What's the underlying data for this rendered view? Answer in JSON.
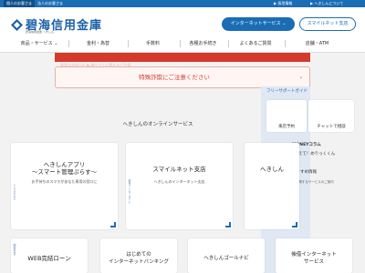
{
  "topbar": {
    "tabs": [
      "個人のお客さま",
      "法人のお客さま"
    ],
    "links": [
      "▶ 採用情報",
      "▶ へきしんについて"
    ]
  },
  "header": {
    "logo_title": "碧海信用金庫",
    "logo_sub": "碧海信用金庫 へきしん",
    "btn_internet": "インターネットサービス  ⌄",
    "btn_smart": "スマイルネット支店"
  },
  "nav": {
    "items": [
      "商品・サービス ⌄",
      "金利・為替",
      "手数料",
      "各種お手続き",
      "よくあるご質問",
      "店舗・ATM"
    ]
  },
  "alerts": {
    "red_text": "重要なお知らせ  ▶  偽サイトに関するご注意",
    "pink_text": "特殊詐欺にご注意ください",
    "pink_arrow": "›"
  },
  "sidebar": {
    "title": "フリーサポートガイド",
    "box1": "来店予約",
    "box2": "チャットで相談",
    "column_title": "MONEYコラム",
    "column_sub": "おしえて！めりっくくん",
    "recommend": "おすすめ情報",
    "recommend_sub": "ご提案に関するサービスのご案内"
  },
  "section": {
    "title": "へきしんのオンラインサービス"
  },
  "cards": [
    {
      "title": "へきしんアプリ\n～スマート管理ぷらす～",
      "desc": "お手持ちのスマホがあなた専用の窓口に",
      "vlabel": "スマホアプリ"
    },
    {
      "title": "スマイルネット支店",
      "desc": "へきしんのインターネット支店",
      "vlabel": "インターネット支店"
    },
    {
      "title": "へきしん",
      "desc": "",
      "vlabel": ""
    },
    {
      "title": "WEB完結ローン",
      "desc": "",
      "vlabel": "WEB完結"
    },
    {
      "title": "はじめての\nインターネットバンキング",
      "desc": "",
      "vlabel": ""
    },
    {
      "title": "へきしんゴールナビ",
      "desc": "",
      "vlabel": ""
    },
    {
      "title": "後借インターネット\nサービス",
      "desc": "",
      "vlabel": ""
    }
  ]
}
